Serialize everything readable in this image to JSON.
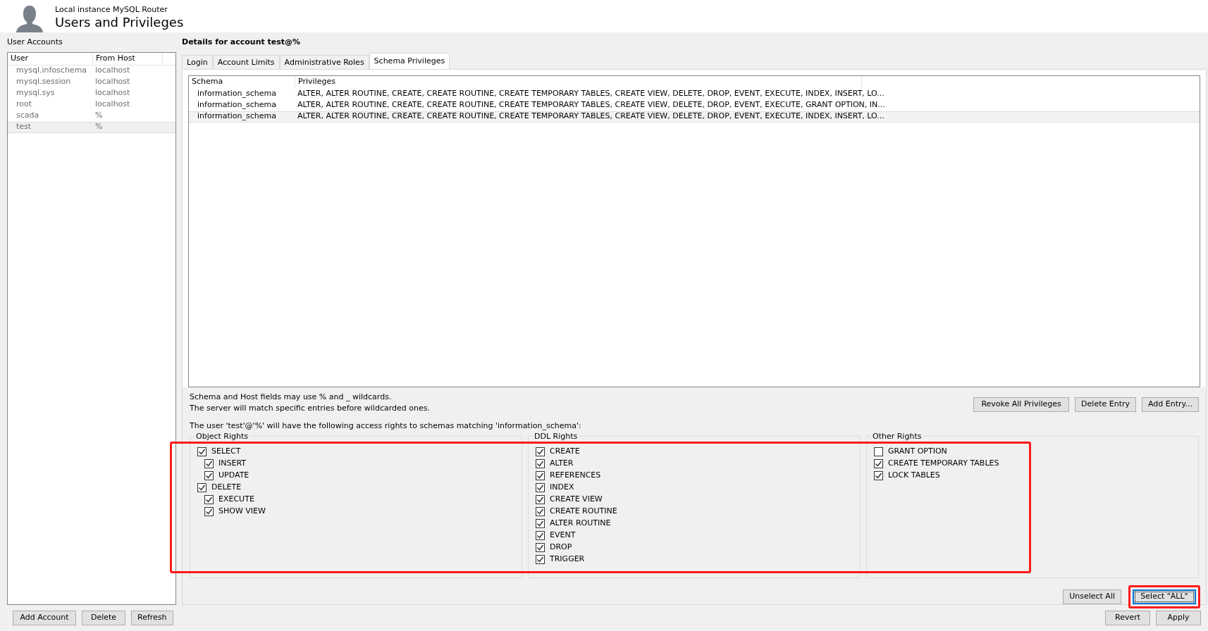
{
  "header": {
    "subtitle": "Local instance MySQL Router",
    "title": "Users and Privileges"
  },
  "accounts": {
    "label": "User Accounts",
    "columns": [
      "User",
      "From Host"
    ],
    "rows": [
      {
        "user": "mysql.infoschema",
        "host": "localhost",
        "selected": false
      },
      {
        "user": "mysql.session",
        "host": "localhost",
        "selected": false
      },
      {
        "user": "mysql.sys",
        "host": "localhost",
        "selected": false
      },
      {
        "user": "root",
        "host": "localhost",
        "selected": false
      },
      {
        "user": "scada",
        "host": "%",
        "selected": false
      },
      {
        "user": "test",
        "host": "%",
        "selected": true
      }
    ],
    "buttons": [
      "Add Account",
      "Delete",
      "Refresh"
    ]
  },
  "details": {
    "title": "Details for account test@%",
    "tabs": [
      {
        "label": "Login",
        "selected": false
      },
      {
        "label": "Account Limits",
        "selected": false
      },
      {
        "label": "Administrative Roles",
        "selected": false
      },
      {
        "label": "Schema Privileges",
        "selected": true
      }
    ],
    "table": {
      "columns": [
        "Schema",
        "Privileges"
      ],
      "rows": [
        {
          "schema": "information_schema",
          "privileges": "ALTER, ALTER ROUTINE, CREATE, CREATE ROUTINE, CREATE TEMPORARY TABLES, CREATE VIEW, DELETE, DROP, EVENT, EXECUTE, INDEX, INSERT, LO...",
          "selected": false
        },
        {
          "schema": "information_schema",
          "privileges": "ALTER, ALTER ROUTINE, CREATE, CREATE ROUTINE, CREATE TEMPORARY TABLES, CREATE VIEW, DELETE, DROP, EVENT, EXECUTE, GRANT OPTION, IN...",
          "selected": false
        },
        {
          "schema": "information_schema",
          "privileges": "ALTER, ALTER ROUTINE, CREATE, CREATE ROUTINE, CREATE TEMPORARY TABLES, CREATE VIEW, DELETE, DROP, EVENT, EXECUTE, INDEX, INSERT, LO...",
          "selected": true
        }
      ]
    },
    "notes": [
      "Schema and Host fields may use % and _ wildcards.",
      "The server will match specific entries before wildcarded ones."
    ],
    "entry_buttons": [
      "Revoke All Privileges",
      "Delete Entry",
      "Add Entry..."
    ],
    "rights_intro": "The user 'test'@'%' will have the following access rights to schemas matching 'information_schema':",
    "rights_highlighted": true,
    "groups": [
      {
        "title": "Object Rights",
        "items": [
          {
            "label": "SELECT",
            "checked": true,
            "children": [
              {
                "label": "INSERT",
                "checked": true
              },
              {
                "label": "UPDATE",
                "checked": true
              }
            ]
          },
          {
            "label": "DELETE",
            "checked": true,
            "children": [
              {
                "label": "EXECUTE",
                "checked": true
              },
              {
                "label": "SHOW VIEW",
                "checked": true
              }
            ]
          }
        ]
      },
      {
        "title": "DDL Rights",
        "items": [
          {
            "label": "CREATE",
            "checked": true
          },
          {
            "label": "ALTER",
            "checked": true
          },
          {
            "label": "REFERENCES",
            "checked": true
          },
          {
            "label": "INDEX",
            "checked": true
          },
          {
            "label": "CREATE VIEW",
            "checked": true
          },
          {
            "label": "CREATE ROUTINE",
            "checked": true
          },
          {
            "label": "ALTER ROUTINE",
            "checked": true
          },
          {
            "label": "EVENT",
            "checked": true
          },
          {
            "label": "DROP",
            "checked": true
          },
          {
            "label": "TRIGGER",
            "checked": true
          }
        ]
      },
      {
        "title": "Other Rights",
        "items": [
          {
            "label": "GRANT OPTION",
            "checked": false
          },
          {
            "label": "CREATE TEMPORARY TABLES",
            "checked": true
          },
          {
            "label": "LOCK TABLES",
            "checked": true
          }
        ]
      }
    ],
    "select_buttons": [
      {
        "label": "Unselect All",
        "focused": false,
        "highlighted": false
      },
      {
        "label": "Select \"ALL\"",
        "focused": true,
        "highlighted": true
      }
    ]
  },
  "footer_buttons": [
    "Revert",
    "Apply"
  ]
}
